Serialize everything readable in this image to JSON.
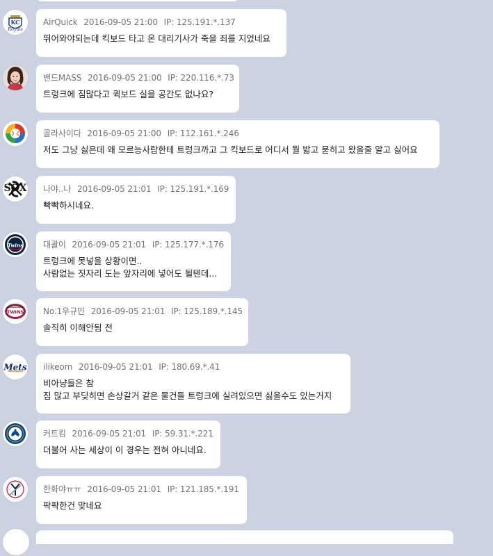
{
  "comments": [
    {
      "avatar_icon": "kansas-city-royals-logo-icon",
      "nickname": "AirQuick",
      "datetime": "2016-09-05 21:00",
      "ip": "IP: 125.191.*.137",
      "lines": [
        "뛰어와야되는데 킥보드 타고 온 대리기사가 죽을 죄를 지었네요"
      ]
    },
    {
      "avatar_icon": "user-photo-avatar-icon",
      "nickname": "밴드MASS",
      "datetime": "2016-09-05 21:00",
      "ip": "IP: 220.116.*.73",
      "lines": [
        "트렁크에 짐많다고 퀵보드 실을 공간도 없나요?"
      ]
    },
    {
      "avatar_icon": "world-baseball-classic-logo-icon",
      "nickname": "콜라사이다",
      "datetime": "2016-09-05 21:00",
      "ip": "IP: 112.161.*.246",
      "lines": [
        "저도 그냥 싫은데 왜 모르능사람한테 트렁크까고 그 킥보드로 어디서 뭘 밟고 묻히고 왔을줄 알고 싫어요"
      ]
    },
    {
      "avatar_icon": "chicago-white-sox-logo-icon",
      "nickname": "나야..나",
      "datetime": "2016-09-05 21:01",
      "ip": "IP: 125.191.*.169",
      "lines": [
        "빡빡하시네요."
      ]
    },
    {
      "avatar_icon": "minnesota-twins-logo-icon",
      "nickname": "대괄이",
      "datetime": "2016-09-05 21:01",
      "ip": "IP: 125.177.*.176",
      "lines": [
        "트렁크에 못넣을 상황이면..",
        "사람없는 짓자리 도는 앞자리에 넣어도 될텐데..."
      ]
    },
    {
      "avatar_icon": "lg-twins-logo-icon",
      "nickname": "No.1우규민",
      "datetime": "2016-09-05 21:01",
      "ip": "IP: 125.189.*.145",
      "lines": [
        "솔직히 이해안됨 전"
      ]
    },
    {
      "avatar_icon": "new-york-mets-logo-icon",
      "nickname": "ilikeom",
      "datetime": "2016-09-05 21:01",
      "ip": "IP: 180.69.*.41",
      "lines": [
        "비아냥들은 참",
        "짐 많고 부딪히면 손상갈거 같은 물건들 트렁크에 실려있으면 싫을수도 있는거지"
      ]
    },
    {
      "avatar_icon": "chelsea-fc-crest-icon",
      "nickname": "커트킴",
      "datetime": "2016-09-05 21:01",
      "ip": "IP: 59.31.*.221",
      "lines": [
        "더불어 사는 세상이 이 경우는 전혀 아니네요."
      ]
    },
    {
      "avatar_icon": "new-york-yankees-logo-icon",
      "nickname": "한화야ㅠㅠ",
      "datetime": "2016-09-05 21:01",
      "ip": "IP: 121.185.*.191",
      "lines": [
        "팍팍한건 맞네요"
      ]
    }
  ]
}
